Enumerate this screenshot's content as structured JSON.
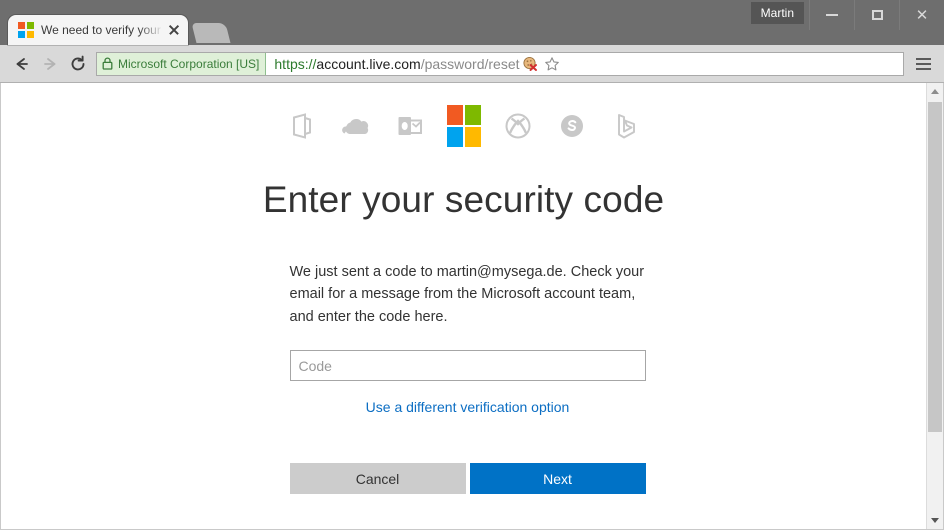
{
  "window": {
    "profile_label": "Martin",
    "minimize_label": "Minimize",
    "maximize_label": "Maximize",
    "close_label": "Close"
  },
  "tab": {
    "title": "We need to verify your ide",
    "close_label": "Close tab",
    "new_tab_label": "New tab",
    "favicon": "microsoft-logo-icon",
    "favicon_colors": {
      "top_left": "#f15a22",
      "top_right": "#7eb900",
      "bottom_left": "#00a3ee",
      "bottom_right": "#ffb900"
    }
  },
  "toolbar": {
    "back_icon": "back-arrow-icon",
    "forward_icon": "forward-arrow-icon",
    "reload_icon": "reload-icon",
    "security_badge": {
      "lock_icon": "lock-icon",
      "label": "Microsoft Corporation [US]",
      "background": "#dff0d8",
      "text_color": "#3b7d3b"
    },
    "url": {
      "scheme": "https://",
      "host": "account.live.com",
      "path": "/password/reset",
      "full": "https://account.live.com/password/reset"
    },
    "cookie_blocked_icon": "cookie-blocked-icon",
    "bookmark_icon": "star-icon",
    "menu_icon": "hamburger-menu-icon"
  },
  "page": {
    "logos": [
      {
        "name": "office-icon",
        "glyph": "office"
      },
      {
        "name": "onedrive-icon",
        "glyph": "onedrive"
      },
      {
        "name": "outlook-icon",
        "glyph": "outlook"
      },
      {
        "name": "microsoft-icon",
        "glyph": "microsoft"
      },
      {
        "name": "xbox-icon",
        "glyph": "xbox"
      },
      {
        "name": "skype-icon",
        "glyph": "skype"
      },
      {
        "name": "bing-icon",
        "glyph": "bing"
      }
    ],
    "heading": "Enter your security code",
    "body_text": "We just sent a code to martin@mysega.de. Check your email for a message from the Microsoft account team, and enter the code here.",
    "email": "martin@mysega.de",
    "code_input": {
      "placeholder": "Code",
      "value": ""
    },
    "alt_verification_link": "Use a different verification option",
    "buttons": {
      "cancel": "Cancel",
      "next": "Next"
    },
    "colors": {
      "accent_blue": "#0072c6",
      "link_blue": "#0c6ec3",
      "cancel_gray": "#cccccc"
    }
  },
  "scrollbar": {
    "up_arrow": "scroll-up-arrow-icon",
    "down_arrow": "scroll-down-arrow-icon"
  }
}
